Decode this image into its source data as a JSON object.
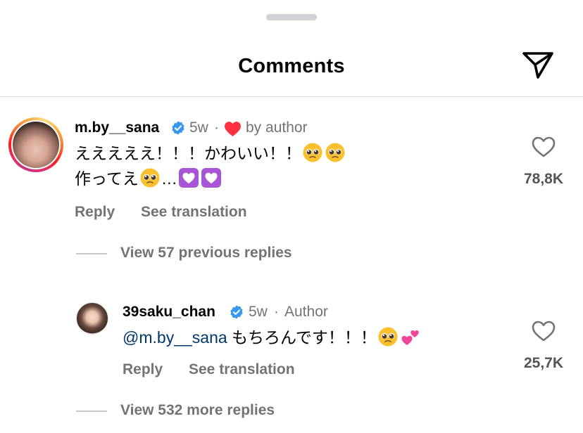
{
  "header": {
    "title": "Comments",
    "share_icon": "send-icon"
  },
  "comments": [
    {
      "username": "m.by__sana",
      "verified": true,
      "time": "5w",
      "separator": "·",
      "liked_by_author_label": "by author",
      "text_line1": "えええええ！！！かわいい！！",
      "text_line2a": "作ってえ",
      "text_line2b": "…",
      "emojis": [
        "pleading-face",
        "pleading-face",
        "pleading-face",
        "white-heart-purple",
        "white-heart-purple"
      ],
      "reply_label": "Reply",
      "translate_label": "See translation",
      "likes": "78,8K"
    }
  ],
  "replies_toggle_previous": "View 57 previous replies",
  "reply": {
    "username": "39saku_chan",
    "verified": true,
    "time": "5w",
    "separator": "·",
    "author_badge": "Author",
    "mention": "@m.by__sana",
    "text": " もちろんです！！！",
    "emojis": [
      "pleading-face",
      "two-hearts"
    ],
    "reply_label": "Reply",
    "translate_label": "See translation",
    "likes": "25,7K"
  },
  "replies_toggle_more": "View 532 more replies",
  "colors": {
    "accent_verified": "#3897f0",
    "heart_red": "#ff3040",
    "muted_text": "#737373",
    "mention": "#00376b"
  }
}
